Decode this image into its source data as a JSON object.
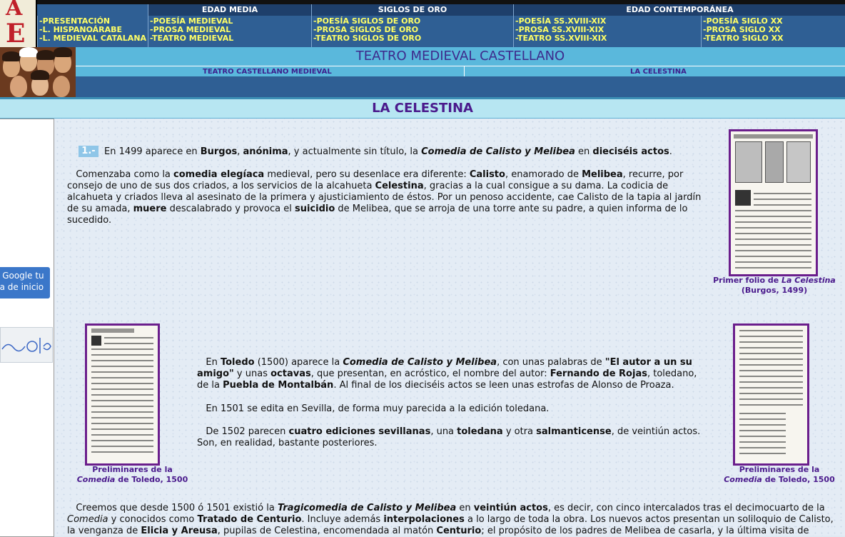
{
  "top_nav": {
    "logo_letters": [
      "A",
      "E"
    ],
    "headers": [
      "EDAD MEDIA",
      "SIGLOS DE ORO",
      "EDAD CONTEMPORÁNEA"
    ],
    "columns": [
      [
        "-PRESENTACIÓN",
        "-L. HISPANOÁRABE",
        "-L. MEDIEVAL CATALANA"
      ],
      [
        "-POESÍA MEDIEVAL",
        "-PROSA MEDIEVAL",
        "-TEATRO MEDIEVAL"
      ],
      [
        "-POESÍA SIGLOS DE ORO",
        "-PROSA SIGLOS DE ORO",
        "-TEATRO SIGLOS DE ORO"
      ],
      [
        "-POESÍA SS.XVIII-XIX",
        "-PROSA SS.XVIII-XIX",
        "-TEATRO SS.XVIII-XIX"
      ],
      [
        "-POESÍA SIGLO XX",
        "-PROSA SIGLO XX",
        "-TEATRO SIGLO XX"
      ]
    ]
  },
  "section": {
    "title": "TEATRO MEDIEVAL CASTELLANO",
    "links": [
      "TEATRO CASTELLANO MEDIEVAL",
      "LA CELESTINA"
    ]
  },
  "page_title": "LA CELESTINA",
  "sidebar": {
    "google_button_lines": [
      "e Google tu",
      "na de inicio"
    ],
    "doodle_icon": "google-doodle-icon"
  },
  "content": {
    "num_badge": "1.-",
    "images": [
      {
        "caption_line1": "Primer folio de ",
        "caption_italic": "La Celestina",
        "caption_line2": "(Burgos, 1499)"
      },
      {
        "caption_line1": "Preliminares de la",
        "caption_italic": "Comedia",
        "caption_line2": " de Toledo, 1500"
      },
      {
        "caption_line1": "Preliminares de la",
        "caption_italic": "Comedia",
        "caption_line2": " de Toledo, 1500"
      }
    ]
  },
  "colors": {
    "nav_bg": "#2f5f94",
    "nav_link": "#ffff66",
    "section_bar": "#5ab8dc",
    "title_purple": "#4a1a8c",
    "frame_purple": "#6b1e8c"
  }
}
